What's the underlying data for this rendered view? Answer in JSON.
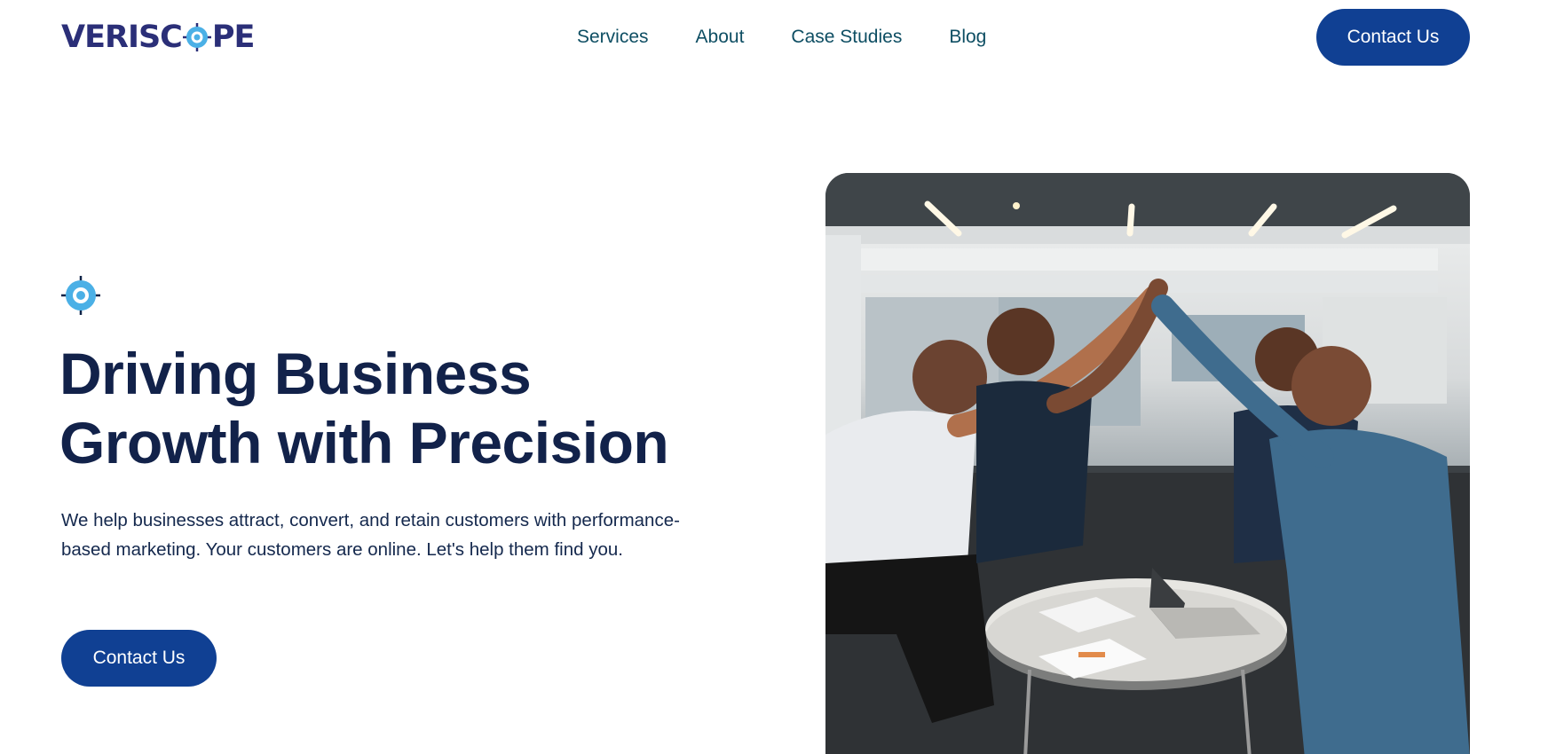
{
  "brand": {
    "name_left": "VERISC",
    "name_right": "PE",
    "accent": "#104093",
    "logo_color": "#2b2f78",
    "target_color": "#4bb0e6"
  },
  "nav": {
    "items": [
      "Services",
      "About",
      "Case Studies",
      "Blog"
    ]
  },
  "header": {
    "cta_label": "Contact Us"
  },
  "hero": {
    "icon": "target-icon",
    "title_line1": "Driving Business",
    "title_line2": "Growth with Precision",
    "text": "We help businesses attract, convert, and retain customers with performance-based marketing. Your customers are online. Let's help them find you.",
    "cta_label": "Contact Us",
    "image": "team-high-five-photo"
  }
}
